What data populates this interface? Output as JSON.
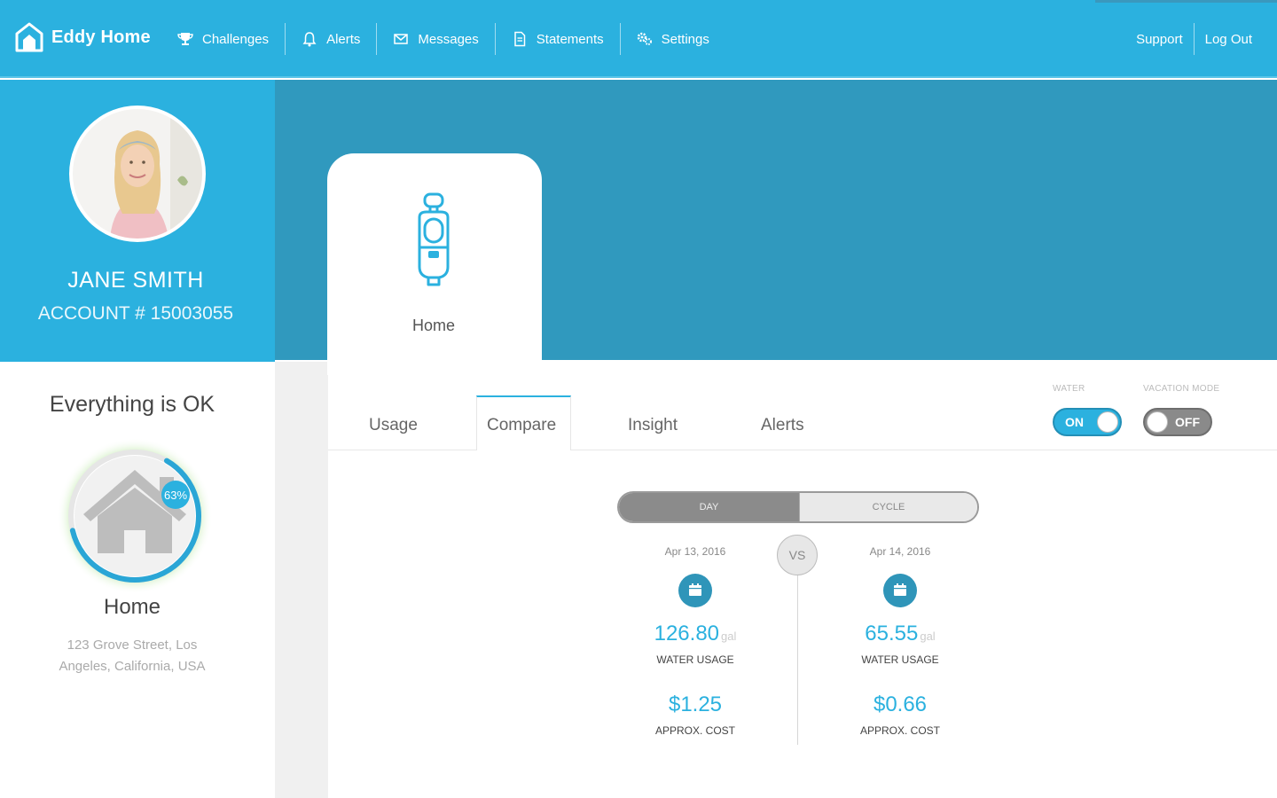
{
  "app": {
    "brand": "Eddy Home"
  },
  "nav": {
    "items": [
      {
        "label": "Challenges",
        "icon": "trophy-icon"
      },
      {
        "label": "Alerts",
        "icon": "bell-icon"
      },
      {
        "label": "Messages",
        "icon": "envelope-icon"
      },
      {
        "label": "Statements",
        "icon": "document-icon"
      },
      {
        "label": "Settings",
        "icon": "gear-icon"
      }
    ],
    "support": "Support",
    "logout": "Log Out"
  },
  "profile": {
    "name": "JANE SMITH",
    "account": "ACCOUNT # 15003055"
  },
  "status": {
    "title": "Everything is OK",
    "percent": "63%",
    "percent_value": 0.63,
    "home_label": "Home",
    "address": "123 Grove Street, Los Angeles, California, USA"
  },
  "device": {
    "label": "Home",
    "icon": "water-sensor-icon"
  },
  "tabs": [
    {
      "label": "Usage",
      "active": false
    },
    {
      "label": "Compare",
      "active": true
    },
    {
      "label": "Insight",
      "active": false
    },
    {
      "label": "Alerts",
      "active": false
    }
  ],
  "toggles": {
    "water": {
      "label": "WATER",
      "state": "ON"
    },
    "vacation": {
      "label": "VACATION MODE",
      "state": "OFF"
    }
  },
  "compare": {
    "segments": {
      "day": "DAY",
      "cycle": "CYCLE",
      "selected": "DAY"
    },
    "vs": "VS",
    "left": {
      "date": "Apr 13, 2016",
      "usage": "126.80",
      "unit": "gal",
      "usage_label": "WATER USAGE",
      "cost": "$1.25",
      "cost_label": "APPROX. COST"
    },
    "right": {
      "date": "Apr 14, 2016",
      "usage": "65.55",
      "unit": "gal",
      "usage_label": "WATER USAGE",
      "cost": "$0.66",
      "cost_label": "APPROX. COST"
    }
  },
  "colors": {
    "primary": "#2bb1df",
    "band": "#3099be",
    "ring": "#2aa6d6",
    "glow": "#8bd86b"
  }
}
